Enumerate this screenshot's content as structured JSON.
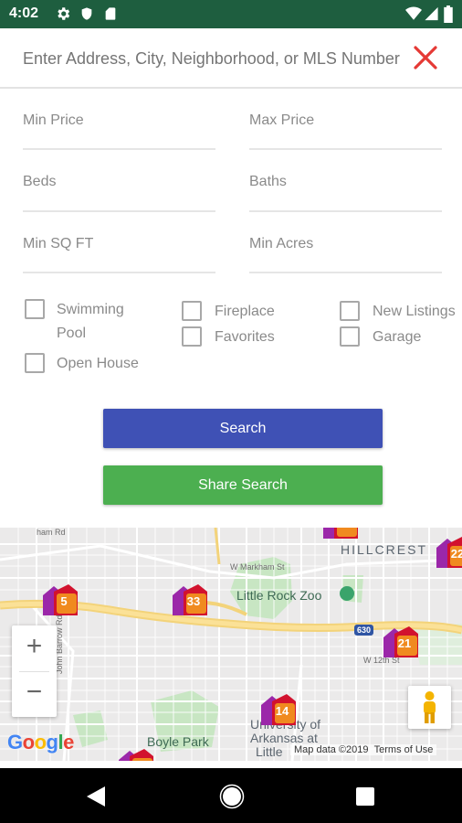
{
  "status_bar": {
    "time": "4:02",
    "left_icons": [
      "gear-icon",
      "shield-icon",
      "sd-card-icon"
    ],
    "right_icons": [
      "wifi-icon",
      "cellular-icon",
      "battery-icon"
    ],
    "background": "#1e5e3f"
  },
  "search": {
    "placeholder": "Enter Address, City, Neighborhood, or MLS Number",
    "clear_icon": "close-icon",
    "clear_color": "#e53935"
  },
  "filters": {
    "min_price": "Min Price",
    "max_price": "Max Price",
    "beds": "Beds",
    "baths": "Baths",
    "min_sqft": "Min SQ FT",
    "min_acres": "Min Acres"
  },
  "checkboxes": {
    "swimming_pool_line1": "Swimming",
    "swimming_pool_line2": "Pool",
    "open_house": "Open House",
    "fireplace": "Fireplace",
    "favorites": "Favorites",
    "new_listings": "New Listings",
    "garage": "Garage"
  },
  "buttons": {
    "search": "Search",
    "share_search": "Share Search",
    "search_color": "#3f51b5",
    "share_color": "#4caf50"
  },
  "map": {
    "labels": {
      "hillcrest": "HILLCREST",
      "zoo": "Little Rock Zoo",
      "boyle_park": "Boyle Park",
      "university_1": "University of",
      "university_2": "Arkansas at",
      "university_3": "Little"
    },
    "streets": {
      "markham": "W Markham St",
      "twelfth": "W 12th St",
      "barrow": "John Barrow Rd",
      "hamm": "ham Rd"
    },
    "highway_shield": "630",
    "clusters": [
      {
        "count": "5"
      },
      {
        "count": "33"
      },
      {
        "count": "21"
      },
      {
        "count": "22"
      },
      {
        "count": "14"
      }
    ],
    "zoom_in": "+",
    "zoom_out": "−",
    "logo": "Google",
    "attribution": "Map data ©2019",
    "terms": "Terms of Use"
  },
  "nav_bar": {
    "back_icon": "back-triangle-icon",
    "home_icon": "home-circle-icon",
    "recents_icon": "recents-square-icon"
  }
}
